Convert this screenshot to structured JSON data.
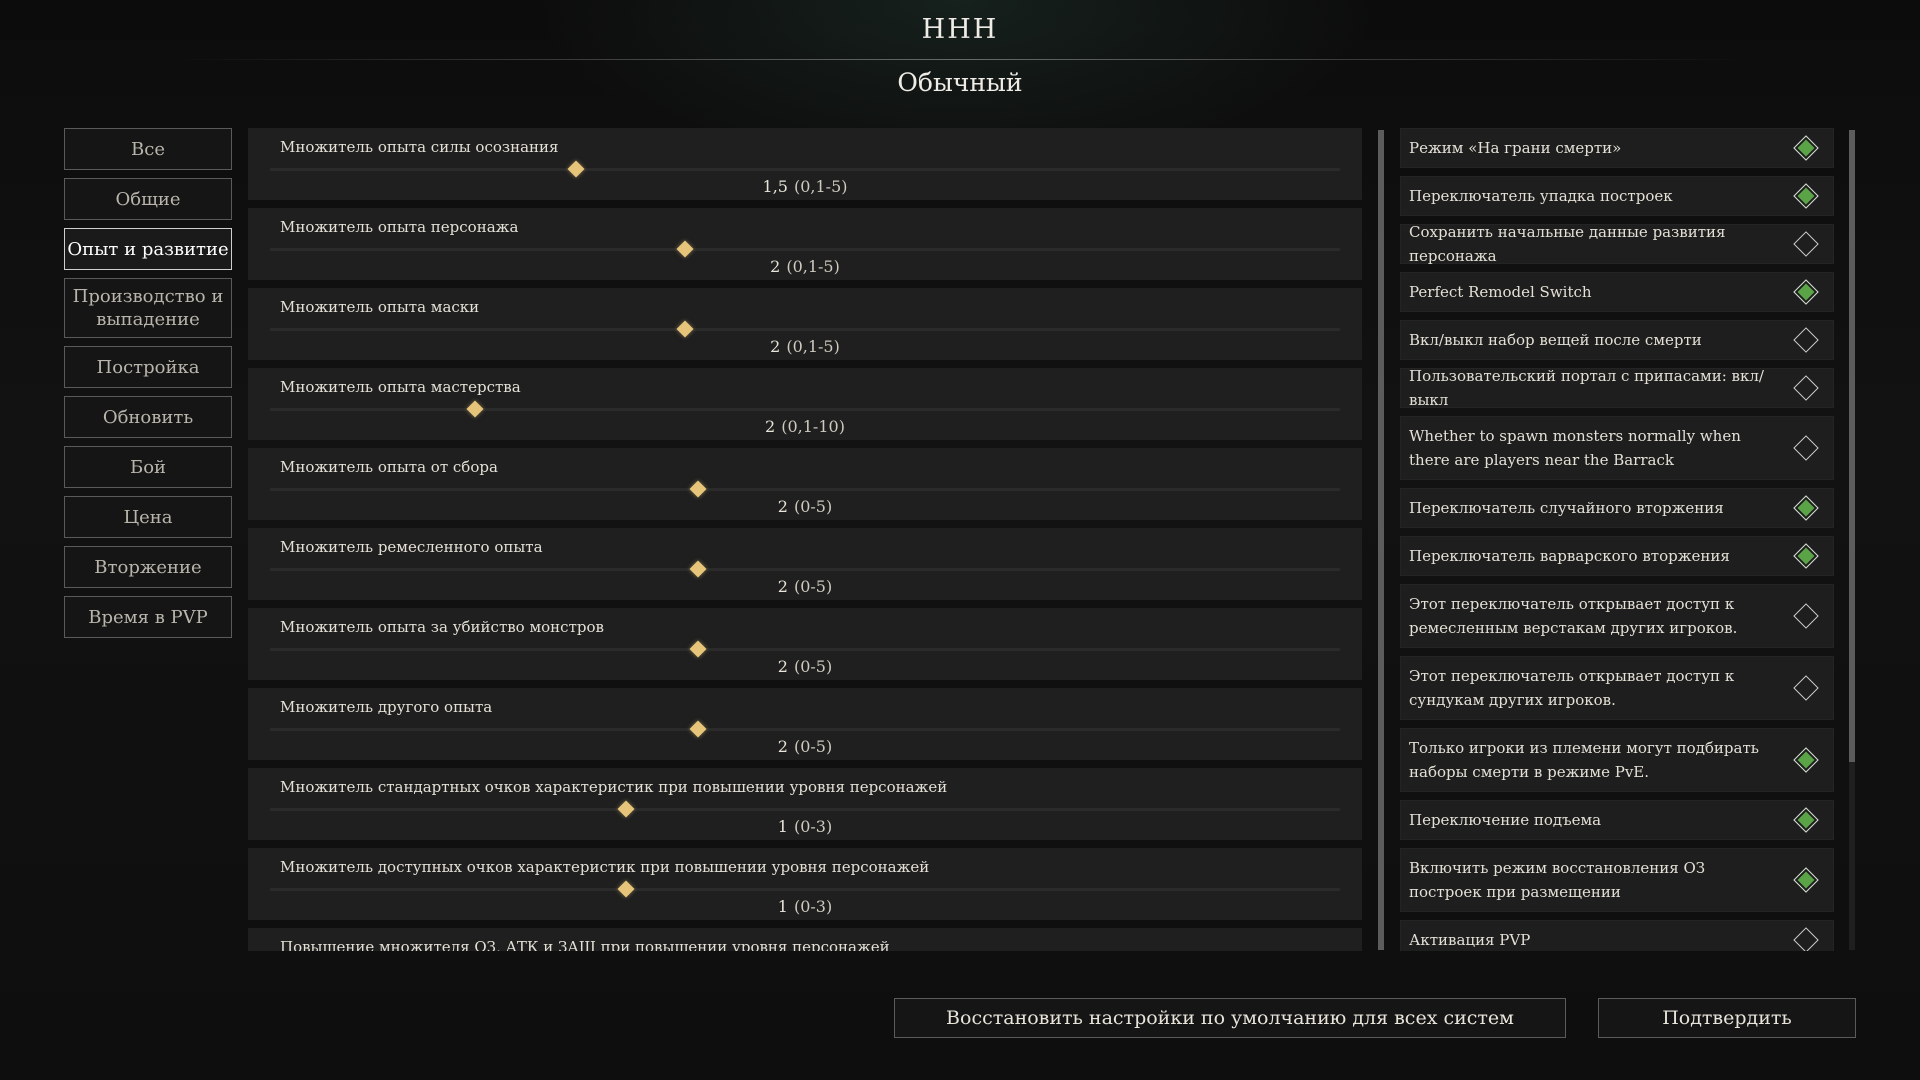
{
  "header": {
    "title": "HHH",
    "mode": "Обычный"
  },
  "nav": {
    "items": [
      {
        "label": "Все",
        "active": false
      },
      {
        "label": "Общие",
        "active": false
      },
      {
        "label": "Опыт и развитие",
        "active": true
      },
      {
        "label": "Производство и выпадение",
        "active": false
      },
      {
        "label": "Постройка",
        "active": false
      },
      {
        "label": "Обновить",
        "active": false
      },
      {
        "label": "Бой",
        "active": false
      },
      {
        "label": "Цена",
        "active": false
      },
      {
        "label": "Вторжение",
        "active": false
      },
      {
        "label": "Время в PVP",
        "active": false
      }
    ]
  },
  "sliders": [
    {
      "label": "Множитель опыта силы осознания",
      "value": "1,5",
      "range": "(0,1-5)",
      "position": 0.286
    },
    {
      "label": "Множитель опыта персонажа",
      "value": "2",
      "range": "(0,1-5)",
      "position": 0.388
    },
    {
      "label": "Множитель опыта маски",
      "value": "2",
      "range": "(0,1-5)",
      "position": 0.388
    },
    {
      "label": "Множитель опыта мастерства",
      "value": "2",
      "range": "(0,1-10)",
      "position": 0.192
    },
    {
      "label": "Множитель опыта от сбора",
      "value": "2",
      "range": "(0-5)",
      "position": 0.4
    },
    {
      "label": "Множитель ремесленного опыта",
      "value": "2",
      "range": "(0-5)",
      "position": 0.4
    },
    {
      "label": "Множитель опыта за убийство монстров",
      "value": "2",
      "range": "(0-5)",
      "position": 0.4
    },
    {
      "label": "Множитель другого опыта",
      "value": "2",
      "range": "(0-5)",
      "position": 0.4
    },
    {
      "label": "Множитель стандартных очков характеристик при повышении уровня персонажей",
      "value": "1",
      "range": "(0-3)",
      "position": 0.333
    },
    {
      "label": "Множитель доступных очков характеристик при повышении уровня персонажей",
      "value": "1",
      "range": "(0-3)",
      "position": 0.333
    },
    {
      "label": "Повышение множителя ОЗ, АТК и ЗАЩ при повышении уровня персонажей",
      "value": "",
      "range": "",
      "position": 0.333
    }
  ],
  "toggles": [
    {
      "label": "Режим «На грани смерти»",
      "on": true
    },
    {
      "label": "Переключатель упадка построек",
      "on": true
    },
    {
      "label": "Сохранить начальные данные развития персонажа",
      "on": false
    },
    {
      "label": "Perfect Remodel Switch",
      "on": true
    },
    {
      "label": "Вкл/выкл набор вещей после смерти",
      "on": false
    },
    {
      "label": "Пользовательский портал с припасами: вкл/выкл",
      "on": false
    },
    {
      "label": "Whether to spawn monsters normally when there are players near the Barrack",
      "on": false
    },
    {
      "label": "Переключатель случайного вторжения",
      "on": true
    },
    {
      "label": "Переключатель варварского вторжения",
      "on": true
    },
    {
      "label": "Этот переключатель открывает доступ к ремесленным верстакам других игроков.",
      "on": false
    },
    {
      "label": "Этот переключатель открывает доступ к сундукам других игроков.",
      "on": false
    },
    {
      "label": "Только игроки из племени могут подбирать наборы смерти в режиме PvE.",
      "on": true
    },
    {
      "label": "Переключение подъема",
      "on": true
    },
    {
      "label": "Включить режим восстановления ОЗ построек при размещении",
      "on": true
    },
    {
      "label": "Активация PVP",
      "on": false
    }
  ],
  "footer": {
    "restore_label": "Восстановить настройки по умолчанию для всех систем",
    "confirm_label": "Подтвердить"
  },
  "colors": {
    "toggle_on": "#5aa447",
    "slider_thumb": "#e6c47a"
  }
}
